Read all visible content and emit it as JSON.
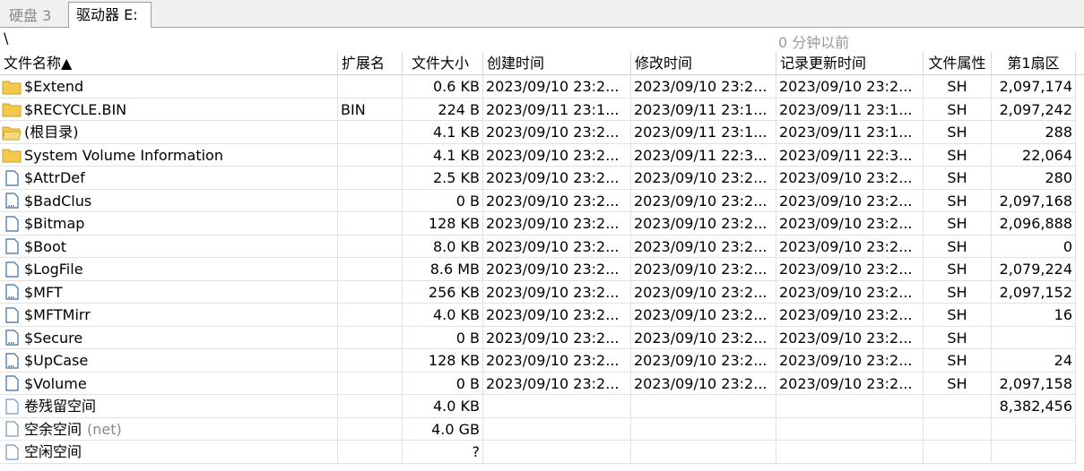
{
  "tabs": [
    {
      "label": "硬盘 3",
      "active": false
    },
    {
      "label": "驱动器 E:",
      "active": true
    }
  ],
  "path": "\\",
  "updated": "0 分钟以前",
  "columns": {
    "name": "文件名称▲",
    "ext": "扩展名",
    "size": "文件大小",
    "created": "创建时间",
    "modified": "修改时间",
    "record": "记录更新时间",
    "attr": "文件属性",
    "sector": "第1扇区"
  },
  "rows": [
    {
      "icon": "folder-icon",
      "name": "$Extend",
      "note": "",
      "ext": "",
      "size": "0.6 KB",
      "created": "2023/09/10  23:2...",
      "modified": "2023/09/10  23:2...",
      "record": "2023/09/10  23:2...",
      "attr": "SH",
      "sector": "2,097,174"
    },
    {
      "icon": "folder-icon",
      "name": "$RECYCLE.BIN",
      "note": "",
      "ext": "BIN",
      "size": "224 B",
      "created": "2023/09/11  23:1...",
      "modified": "2023/09/11  23:1...",
      "record": "2023/09/11  23:1...",
      "attr": "SH",
      "sector": "2,097,242"
    },
    {
      "icon": "folder-open-icon",
      "name": "(根目录)",
      "note": "",
      "ext": "",
      "size": "4.1 KB",
      "created": "2023/09/10  23:2...",
      "modified": "2023/09/11  23:1...",
      "record": "2023/09/11  23:1...",
      "attr": "SH",
      "sector": "288"
    },
    {
      "icon": "folder-icon",
      "name": "System Volume Information",
      "note": "",
      "ext": "",
      "size": "4.1 KB",
      "created": "2023/09/10  23:2...",
      "modified": "2023/09/11  22:3...",
      "record": "2023/09/11  22:3...",
      "attr": "SH",
      "sector": "22,064"
    },
    {
      "icon": "file-icon",
      "name": "$AttrDef",
      "note": "",
      "ext": "",
      "size": "2.5 KB",
      "created": "2023/09/10  23:2...",
      "modified": "2023/09/10  23:2...",
      "record": "2023/09/10  23:2...",
      "attr": "SH",
      "sector": "280"
    },
    {
      "icon": "file-dots-icon",
      "name": "$BadClus",
      "note": "",
      "ext": "",
      "size": "0 B",
      "created": "2023/09/10  23:2...",
      "modified": "2023/09/10  23:2...",
      "record": "2023/09/10  23:2...",
      "attr": "SH",
      "sector": "2,097,168"
    },
    {
      "icon": "file-icon",
      "name": "$Bitmap",
      "note": "",
      "ext": "",
      "size": "128 KB",
      "created": "2023/09/10  23:2...",
      "modified": "2023/09/10  23:2...",
      "record": "2023/09/10  23:2...",
      "attr": "SH",
      "sector": "2,096,888"
    },
    {
      "icon": "file-icon",
      "name": "$Boot",
      "note": "",
      "ext": "",
      "size": "8.0 KB",
      "created": "2023/09/10  23:2...",
      "modified": "2023/09/10  23:2...",
      "record": "2023/09/10  23:2...",
      "attr": "SH",
      "sector": "0"
    },
    {
      "icon": "file-icon",
      "name": "$LogFile",
      "note": "",
      "ext": "",
      "size": "8.6 MB",
      "created": "2023/09/10  23:2...",
      "modified": "2023/09/10  23:2...",
      "record": "2023/09/10  23:2...",
      "attr": "SH",
      "sector": "2,079,224"
    },
    {
      "icon": "file-dots-icon",
      "name": "$MFT",
      "note": "",
      "ext": "",
      "size": "256 KB",
      "created": "2023/09/10  23:2...",
      "modified": "2023/09/10  23:2...",
      "record": "2023/09/10  23:2...",
      "attr": "SH",
      "sector": "2,097,152"
    },
    {
      "icon": "file-icon",
      "name": "$MFTMirr",
      "note": "",
      "ext": "",
      "size": "4.0 KB",
      "created": "2023/09/10  23:2...",
      "modified": "2023/09/10  23:2...",
      "record": "2023/09/10  23:2...",
      "attr": "SH",
      "sector": "16"
    },
    {
      "icon": "file-dots-icon",
      "name": "$Secure",
      "note": "",
      "ext": "",
      "size": "0 B",
      "created": "2023/09/10  23:2...",
      "modified": "2023/09/10  23:2...",
      "record": "2023/09/10  23:2...",
      "attr": "SH",
      "sector": ""
    },
    {
      "icon": "file-dots-icon",
      "name": "$UpCase",
      "note": "",
      "ext": "",
      "size": "128 KB",
      "created": "2023/09/10  23:2...",
      "modified": "2023/09/10  23:2...",
      "record": "2023/09/10  23:2...",
      "attr": "SH",
      "sector": "24"
    },
    {
      "icon": "file-icon",
      "name": "$Volume",
      "note": "",
      "ext": "",
      "size": "0 B",
      "created": "2023/09/10  23:2...",
      "modified": "2023/09/10  23:2...",
      "record": "2023/09/10  23:2...",
      "attr": "SH",
      "sector": "2,097,158"
    },
    {
      "icon": "file-plain-icon",
      "name": "卷残留空间",
      "note": "",
      "ext": "",
      "size": "4.0 KB",
      "created": "",
      "modified": "",
      "record": "",
      "attr": "",
      "sector": "8,382,456"
    },
    {
      "icon": "file-plain-icon",
      "name": "空余空间",
      "note": "(net)",
      "ext": "",
      "size": "4.0 GB",
      "created": "",
      "modified": "",
      "record": "",
      "attr": "",
      "sector": ""
    },
    {
      "icon": "file-plain-icon",
      "name": "空闲空间",
      "note": "",
      "ext": "",
      "size": "?",
      "created": "",
      "modified": "",
      "record": "",
      "attr": "",
      "sector": ""
    }
  ],
  "colors": {
    "folder": "#f2c94c",
    "folder_border": "#c9a227",
    "file_fill": "#ffffff",
    "file_border": "#3a6ea5"
  }
}
